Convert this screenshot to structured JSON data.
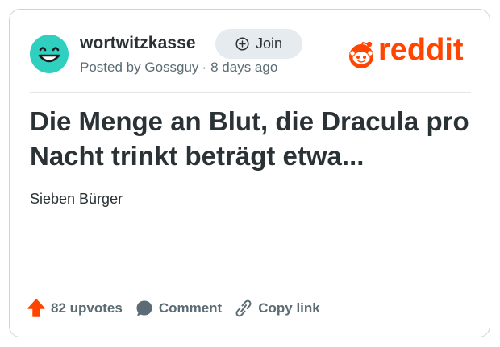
{
  "post": {
    "community": "wortwitzkasse",
    "join_label": "Join",
    "posted_by_prefix": "Posted by",
    "author": "Gossguy",
    "separator": "·",
    "age": "8 days ago",
    "title": "Die Menge an Blut, die Dracula pro Nacht trinkt beträgt etwa...",
    "body": "Sieben Bürger"
  },
  "brand": {
    "logo_text": "reddit",
    "color": "#ff4500",
    "avatar_color": "#2fd0c0"
  },
  "actions": {
    "upvotes_label": "82 upvotes",
    "comment_label": "Comment",
    "copy_link_label": "Copy link"
  },
  "icons": {
    "avatar": "smiley-face-icon",
    "join": "plus-circle-icon",
    "logo": "reddit-snoo-icon",
    "upvote": "upvote-arrow-icon",
    "comment": "speech-bubble-icon",
    "copy_link": "link-icon"
  }
}
